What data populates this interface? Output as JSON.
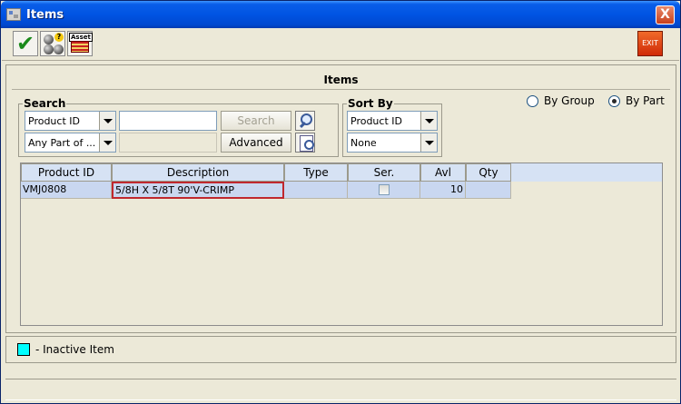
{
  "window": {
    "title": "Items",
    "close_label": "X"
  },
  "toolbar": {
    "ok_icon": "checkmark-icon",
    "group_icon": "group-balls-icon",
    "asset_label": "Asset",
    "exit_label": "EXIT"
  },
  "panel": {
    "title": "Items"
  },
  "search": {
    "legend": "Search",
    "field_select": "Product ID",
    "match_select": "Any Part of ...",
    "query_value": "",
    "search_button": "Search",
    "advanced_button": "Advanced"
  },
  "sort": {
    "legend": "Sort By",
    "primary": "Product ID",
    "secondary": "None"
  },
  "view": {
    "by_group_label": "By Group",
    "by_part_label": "By Part",
    "selected": "By Part"
  },
  "table": {
    "columns": [
      "Product ID",
      "Description",
      "Type",
      "Ser.",
      "Avl",
      "Qty"
    ],
    "rows": [
      {
        "product_id": "VMJ0808",
        "description": "5/8H X 5/8T 90'V-CRIMP",
        "type": "",
        "serialized": false,
        "avl": "10",
        "qty": ""
      }
    ]
  },
  "legend": {
    "text": "- Inactive Item",
    "swatch_color": "#00ffff"
  },
  "colors": {
    "titlebar": "#0054e3",
    "selected_row": "#c9d7f0",
    "selection_border": "#c0282e"
  }
}
